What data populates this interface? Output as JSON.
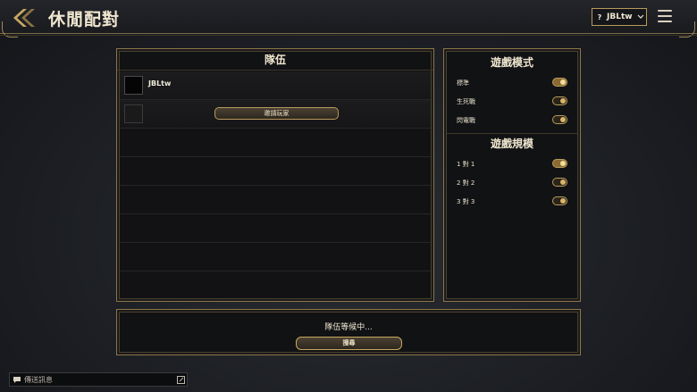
{
  "header": {
    "title": "休閒配對",
    "user_name": "JBLtw",
    "user_prefix": "?"
  },
  "team": {
    "title": "隊伍",
    "players": [
      {
        "name": "JBLtw"
      }
    ],
    "invite_label": "邀請玩家"
  },
  "mode": {
    "title": "遊戲模式",
    "options": [
      {
        "label": "標準",
        "on": true
      },
      {
        "label": "生死戰",
        "on": false
      },
      {
        "label": "閃電戰",
        "on": false
      }
    ]
  },
  "scale": {
    "title": "遊戲規模",
    "options": [
      {
        "label": "1 對 1",
        "on": true
      },
      {
        "label": "2 對 2",
        "on": false
      },
      {
        "label": "3 對 3",
        "on": false
      }
    ]
  },
  "search": {
    "status": "隊伍等候中...",
    "button_label": "搜尋"
  },
  "chat": {
    "placeholder": "傳送訊息"
  },
  "colors": {
    "accent_gold": "#b89a5c",
    "background": "#1c1f24"
  }
}
